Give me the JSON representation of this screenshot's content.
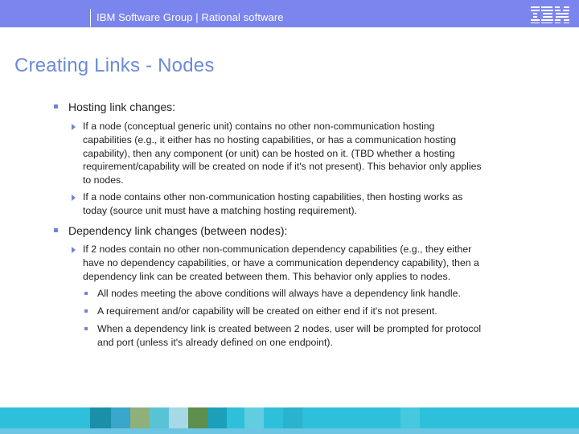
{
  "header": {
    "text": "IBM Software Group | Rational software",
    "logo_text": "IBM"
  },
  "title": "Creating Links - Nodes",
  "sections": [
    {
      "label": "Hosting link changes:",
      "items": [
        {
          "lines": [
            "If a node (conceptual generic unit) contains no other non-communication hosting",
            "capabilities (e.g., it either has no hosting capabilities, or has a communication hosting",
            "capability), then any component (or unit) can be hosted on it.  (TBD whether a hosting",
            "requirement/capability will be created on node if it's not present).  This behavior only applies",
            "to nodes."
          ]
        },
        {
          "lines": [
            "If a node contains other non-communication hosting capabilities, then hosting works as",
            "today (source unit must have a matching hosting requirement)."
          ]
        }
      ]
    },
    {
      "label": "Dependency link changes (between nodes):",
      "items": [
        {
          "lines": [
            "If 2 nodes contain no other non-communication dependency capabilities (e.g., they either",
            "have no dependency capabilities, or have a communication dependency capability), then a",
            "dependency link can be created between them.  This behavior only applies to nodes."
          ],
          "subitems": [
            {
              "lines": [
                "All nodes meeting the above conditions will always have a dependency link handle."
              ]
            },
            {
              "lines": [
                "A requirement and/or capability will be created on either end if it's not present."
              ]
            },
            {
              "lines": [
                "When a dependency link is created between 2 nodes, user will be prompted for protocol",
                "and port (unless it's already defined on one endpoint)."
              ]
            }
          ]
        }
      ]
    }
  ],
  "colors": {
    "header_bg": "#7b85ee",
    "title": "#6b8bd8",
    "bullet": "#6f84d6",
    "footer_band": "#2ec0da"
  }
}
